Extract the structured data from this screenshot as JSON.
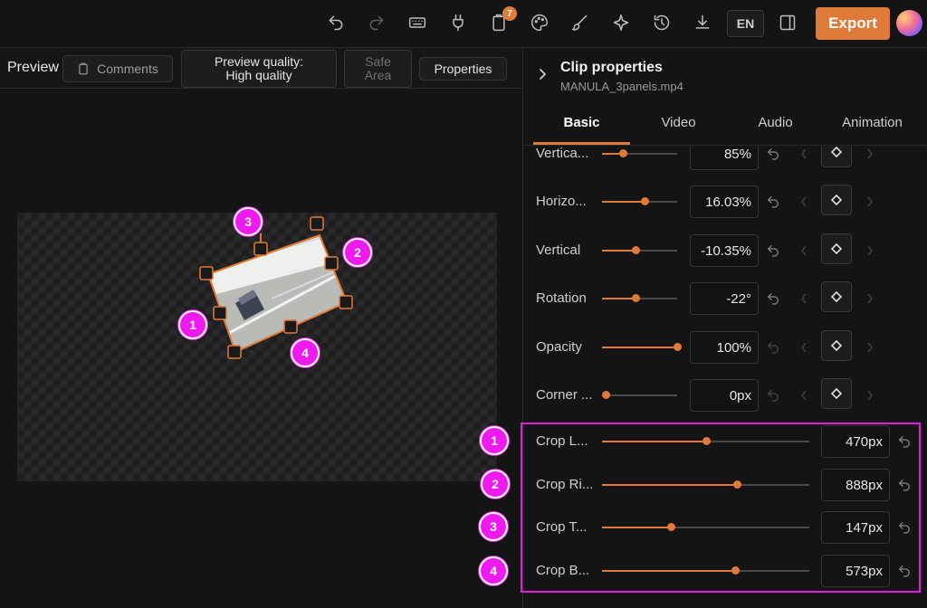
{
  "toolbar": {
    "icons": [
      "undo-icon",
      "redo-icon",
      "keyboard-icon",
      "plug-icon",
      "clipboard-icon",
      "palette-icon",
      "brush-icon",
      "sparkle-icon",
      "history-icon",
      "download-icon",
      "panel-icon"
    ],
    "notification_count": "7",
    "language": "EN",
    "export_label": "Export"
  },
  "preview": {
    "title": "Preview",
    "comments_label": "Comments",
    "quality_label": "Preview quality:",
    "quality_value": "High quality",
    "safe_area_label_1": "Safe",
    "safe_area_label_2": "Area",
    "properties_label": "Properties"
  },
  "canvas_markers": [
    "1",
    "2",
    "3",
    "4"
  ],
  "panel": {
    "title": "Clip properties",
    "filename": "MANULA_3panels.mp4",
    "tabs": [
      "Basic",
      "Video",
      "Audio",
      "Animation"
    ],
    "active_tab": "Basic"
  },
  "properties": [
    {
      "label": "Vertica...",
      "value": "85%",
      "level": 0.28
    },
    {
      "label": "Horizo...",
      "value": "16.03%",
      "level": 0.57
    },
    {
      "label": "Vertical",
      "value": "-10.35%",
      "level": 0.45
    },
    {
      "label": "Rotation",
      "value": "-22°",
      "level": 0.44
    },
    {
      "label": "Opacity",
      "value": "100%",
      "level": 1.0
    },
    {
      "label": "Corner ...",
      "value": "0px",
      "level": 0.05
    }
  ],
  "crop": [
    {
      "marker": "1",
      "label": "Crop L...",
      "value": "470px",
      "level": 0.5
    },
    {
      "marker": "2",
      "label": "Crop Ri...",
      "value": "888px",
      "level": 0.65
    },
    {
      "marker": "3",
      "label": "Crop T...",
      "value": "147px",
      "level": 0.33
    },
    {
      "marker": "4",
      "label": "Crop B...",
      "value": "573px",
      "level": 0.64
    }
  ],
  "colors": {
    "accent": "#e07a3a",
    "marker": "#ef1af0",
    "highlight_box": "#e11fe0",
    "background": "#141414"
  }
}
